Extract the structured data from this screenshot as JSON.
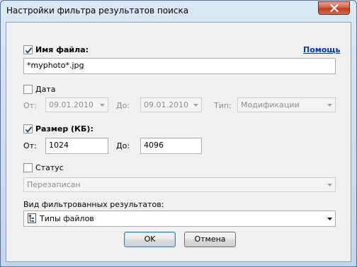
{
  "window": {
    "title": "Настройки фильтра результатов поиска"
  },
  "help": {
    "label": "Помощь"
  },
  "filename": {
    "label": "Имя файла:",
    "checked": true,
    "value": "*myphoto*.jpg"
  },
  "date": {
    "label": "Дата",
    "checked": false,
    "from_label": "От:",
    "from_value": "09.01.2010",
    "to_label": "До:",
    "to_value": "09.01.2010",
    "type_label": "Тип:",
    "type_value": "Модификации"
  },
  "size": {
    "label": "Размер (КБ):",
    "checked": true,
    "from_label": "От:",
    "from_value": "1024",
    "to_label": "До:",
    "to_value": "4096"
  },
  "status": {
    "label": "Статус",
    "checked": false,
    "value": "Перезаписан"
  },
  "view": {
    "label": "Вид фильтрованных результатов:",
    "value": "Типы файлов",
    "icon": "tree-view-icon"
  },
  "buttons": {
    "ok": "OK",
    "cancel": "Отмена"
  }
}
